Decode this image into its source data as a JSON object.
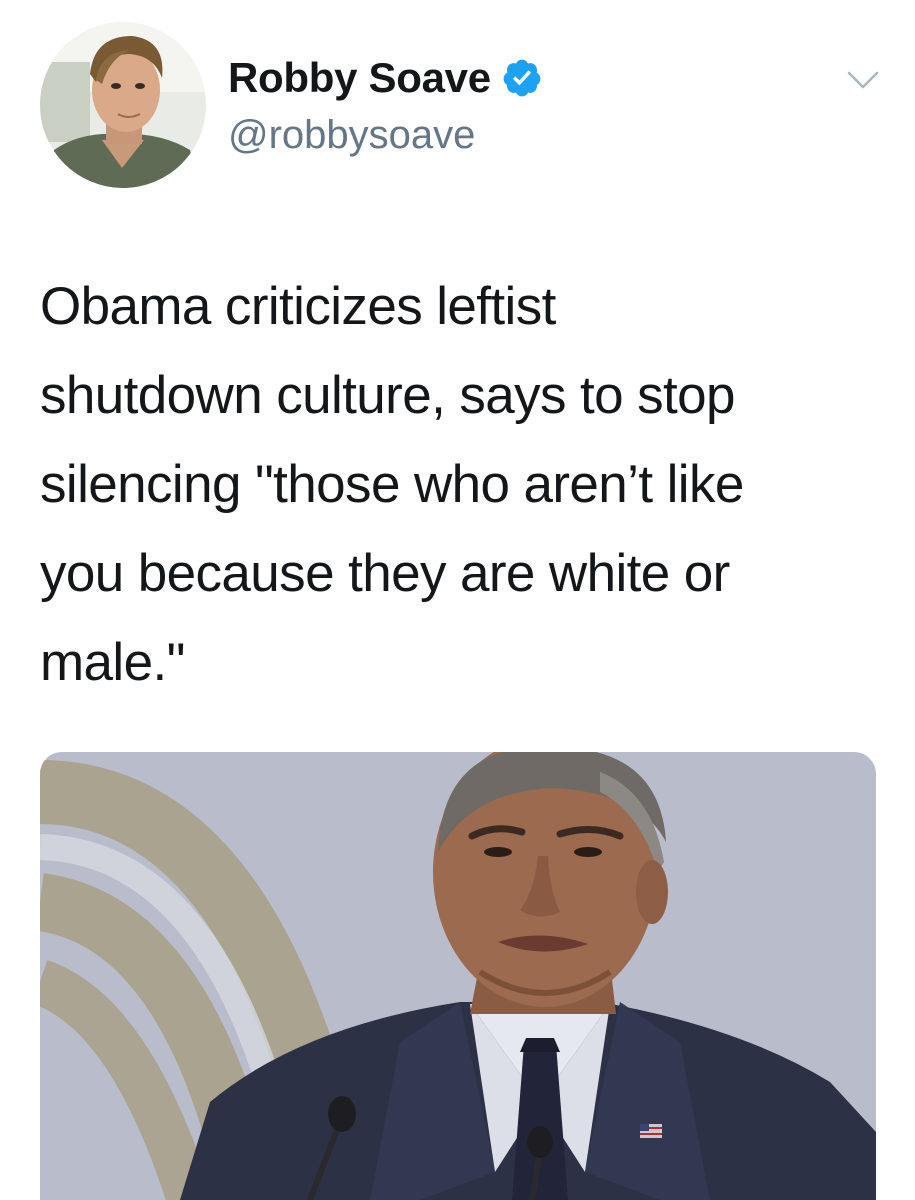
{
  "tweet": {
    "display_name": "Robby Soave",
    "handle": "@robbysoave",
    "verified": true,
    "verified_icon": "verified-badge-icon",
    "menu_icon": "chevron-down-icon",
    "text_lines": [
      "Obama criticizes leftist",
      "shutdown culture, says to stop",
      "silencing \"those who aren’t like",
      "you because they are white or",
      "male.\""
    ]
  },
  "colors": {
    "name": "#14171a",
    "handle": "#657786",
    "verified_blue": "#1da1f2",
    "caret": "#aab8c2"
  }
}
